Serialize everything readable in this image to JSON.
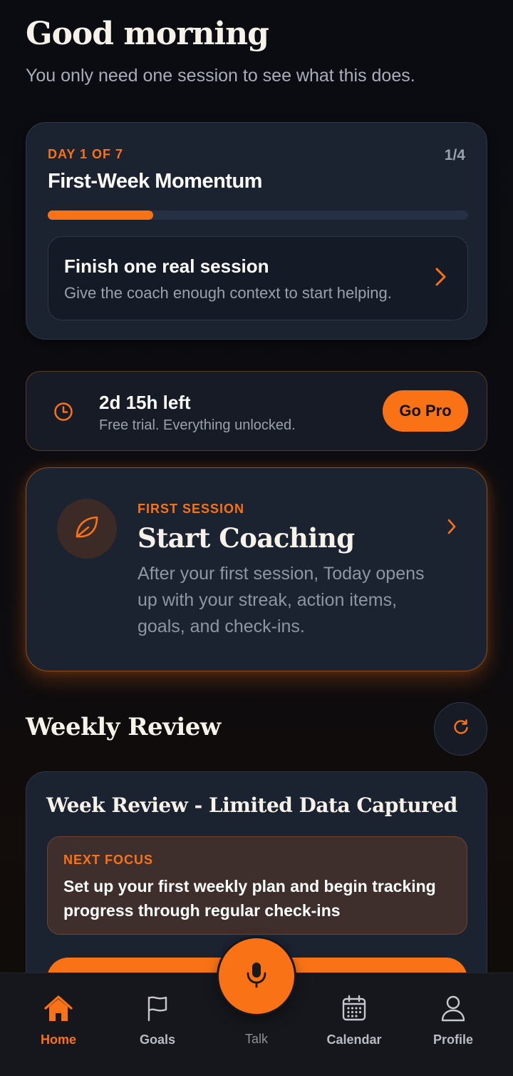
{
  "header": {
    "greeting": "Good morning",
    "subtitle": "You only need one session to see what this does."
  },
  "momentum": {
    "day_label": "DAY 1 OF 7",
    "step_count": "1/4",
    "title": "First-Week Momentum",
    "progress_fraction": 0.25,
    "task_title": "Finish one real session",
    "task_subtitle": "Give the coach enough context to start helping."
  },
  "trial": {
    "time_left": "2d 15h left",
    "subtitle": "Free trial. Everything unlocked.",
    "button_label": "Go Pro",
    "icon": "clock-icon"
  },
  "coaching": {
    "eyebrow": "FIRST SESSION",
    "title": "Start Coaching",
    "description": "After your first session, Today opens up with your streak, action items, goals, and check-ins.",
    "icon": "leaf-icon"
  },
  "weekly_review": {
    "section_title": "Weekly Review",
    "card_title": "Week Review - Limited Data Captured",
    "focus_label": "NEXT FOCUS",
    "focus_text": "Set up your first weekly plan and begin tracking progress through regular check-ins"
  },
  "nav": {
    "home": "Home",
    "goals": "Goals",
    "talk": "Talk",
    "calendar": "Calendar",
    "profile": "Profile"
  },
  "colors": {
    "accent": "#f97316",
    "background": "#0b0c11",
    "card": "#1b2230"
  }
}
